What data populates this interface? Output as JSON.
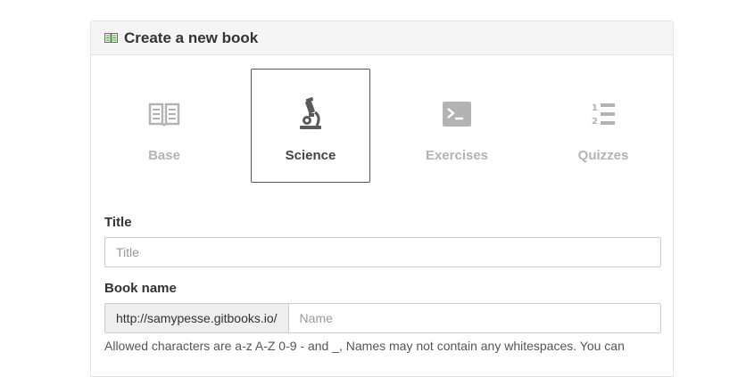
{
  "header": {
    "title": "Create a new book",
    "icon": "book-icon"
  },
  "book_types": [
    {
      "label": "Base",
      "icon": "book-open-icon",
      "selected": false
    },
    {
      "label": "Science",
      "icon": "microscope-icon",
      "selected": true
    },
    {
      "label": "Exercises",
      "icon": "terminal-icon",
      "selected": false
    },
    {
      "label": "Quizzes",
      "icon": "ordered-list-icon",
      "selected": false
    }
  ],
  "form": {
    "title_label": "Title",
    "title_placeholder": "Title",
    "title_value": "",
    "book_name_label": "Book name",
    "book_name_prefix": "http://samypesse.gitbooks.io/",
    "book_name_placeholder": "Name",
    "book_name_value": "",
    "help_text": "Allowed characters are a-z A-Z 0-9 - and _, Names may not contain any whitespaces. You can"
  },
  "colors": {
    "header_bg": "#f5f5f5",
    "border": "#e3e3e3",
    "selected_border": "#555555",
    "muted_icon": "#b3b3b3",
    "active_icon": "#5a5a5a",
    "header_icon": "#4a8a3a",
    "addon_bg": "#eeeeee"
  }
}
